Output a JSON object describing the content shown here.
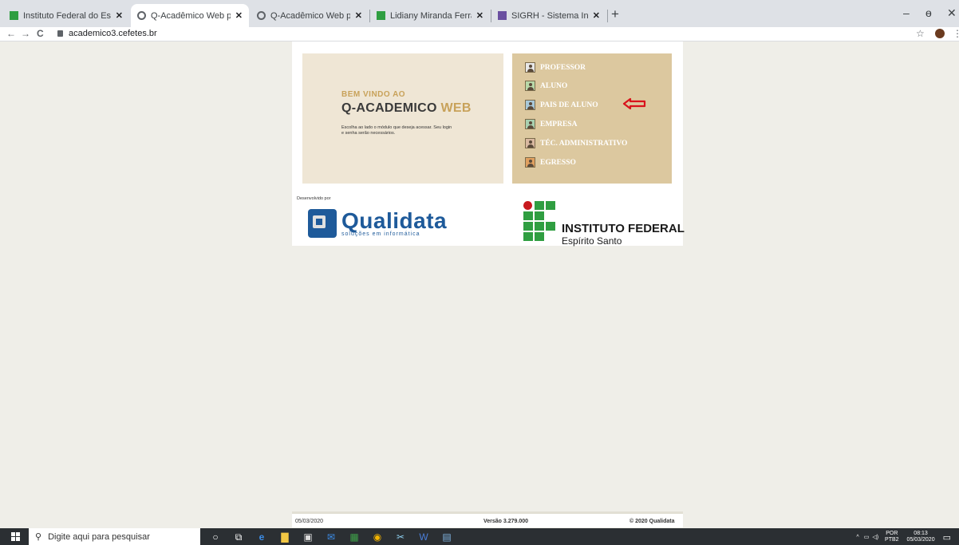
{
  "browser": {
    "tabs": [
      {
        "title": "Instituto Federal do Espírito Santo",
        "close": "✕"
      },
      {
        "title": "Q-Acadêmico Web para CEFET - ",
        "close": "✕"
      },
      {
        "title": "Q-Acadêmico Web para CEFET - ",
        "close": "✕"
      },
      {
        "title": "Lidiany Miranda Ferraz - Outlook",
        "close": "✕"
      },
      {
        "title": "SIGRH - Sistema Integrado de Ge",
        "close": "✕"
      }
    ],
    "new_tab": "+",
    "url": "academico3.cefetes.br",
    "nav": {
      "back": "←",
      "forward": "→",
      "reload": "C"
    },
    "star": "☆",
    "menu_dots": "⋮",
    "window": {
      "minimize": "–",
      "restore": "ɵ",
      "close": "✕"
    }
  },
  "welcome": {
    "greeting": "BEM VINDO AO",
    "title_main": "Q-ACADEMICO",
    "title_accent": "WEB",
    "text": "Escolha ao lado o módulo que deseja acessar. Seu login e senha serão necessários."
  },
  "menu": {
    "items": [
      {
        "label": "PROFESSOR",
        "icon": "professor-icon"
      },
      {
        "label": "ALUNO",
        "icon": "aluno-icon"
      },
      {
        "label": "PAIS DE ALUNO",
        "icon": "pais-de-aluno-icon"
      },
      {
        "label": "EMPRESA",
        "icon": "empresa-icon"
      },
      {
        "label": "TÉC. ADMINISTRATIVO",
        "icon": "tec-administrativo-icon"
      },
      {
        "label": "EGRESSO",
        "icon": "egresso-icon"
      }
    ]
  },
  "developer": {
    "label": "Desenvolvido por",
    "name": "Qualidata",
    "tagline": "soluções em informática"
  },
  "institute": {
    "name": "INSTITUTO FEDERAL",
    "state": "Espírito Santo"
  },
  "footer": {
    "date": "05/03/2020",
    "version": "Versão 3.279.000",
    "copyright": "© 2020 Qualidata"
  },
  "taskbar": {
    "search_placeholder": "Digite aqui para pesquisar",
    "lang": "POR",
    "layout": "PTB2",
    "time": "08:13",
    "date": "05/03/2020"
  },
  "colors": {
    "welcome_bg": "#efe6d5",
    "menu_bg": "#dcc89f",
    "accent_gold": "#c8a25a",
    "if_green": "#2f9e41",
    "if_red": "#c8191e",
    "qualidata_blue": "#1e5a9a",
    "annotation_arrow": "#d9131c"
  }
}
